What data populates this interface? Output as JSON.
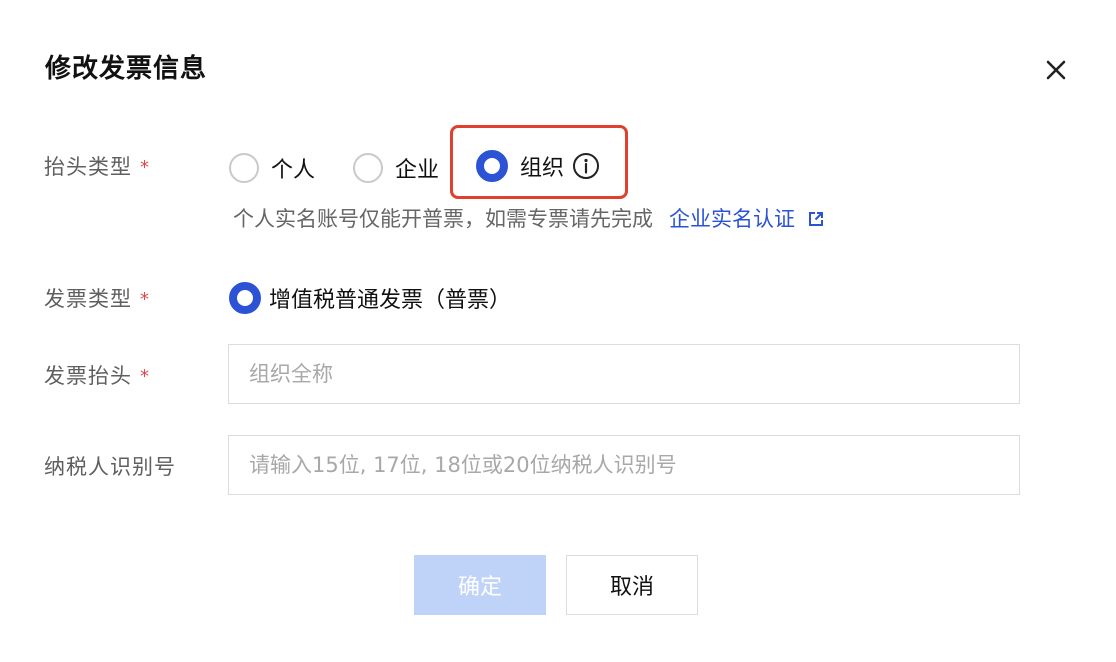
{
  "dialog": {
    "title": "修改发票信息",
    "close_icon": "close-icon"
  },
  "header_type": {
    "label": "抬头类型",
    "required_mark": "*",
    "options": [
      {
        "label": "个人",
        "checked": false
      },
      {
        "label": "企业",
        "checked": false
      },
      {
        "label": "组织",
        "checked": true
      }
    ],
    "info_icon": "info-icon",
    "hint": "个人实名账号仅能开普票，如需专票请先完成",
    "hint_link": "企业实名认证",
    "hint_link_icon": "external-link-icon"
  },
  "invoice_type": {
    "label": "发票类型",
    "required_mark": "*",
    "option": {
      "label": "增值税普通发票（普票）",
      "checked": true
    }
  },
  "invoice_title": {
    "label": "发票抬头",
    "required_mark": "*",
    "value": "",
    "placeholder": "组织全称"
  },
  "taxpayer_id": {
    "label": "纳税人识别号",
    "value": "",
    "placeholder": "请输入15位, 17位, 18位或20位纳税人识别号"
  },
  "buttons": {
    "confirm": "确定",
    "cancel": "取消"
  },
  "colors": {
    "accent": "#2b53d3",
    "required": "#e54545",
    "highlight": "#e0402c",
    "confirm_disabled_bg": "#bfd2f8"
  }
}
